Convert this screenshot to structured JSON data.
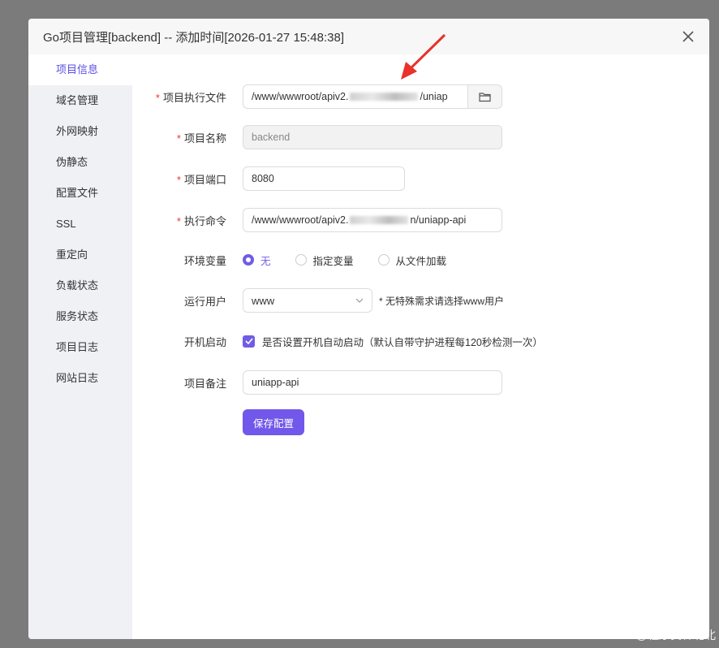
{
  "modal": {
    "title": "Go项目管理[backend] -- 添加时间[2026-01-27 15:48:38]"
  },
  "sidebar": {
    "items": [
      {
        "label": "项目信息",
        "active": true
      },
      {
        "label": "域名管理"
      },
      {
        "label": "外网映射"
      },
      {
        "label": "伪静态"
      },
      {
        "label": "配置文件"
      },
      {
        "label": "SSL"
      },
      {
        "label": "重定向"
      },
      {
        "label": "负载状态"
      },
      {
        "label": "服务状态"
      },
      {
        "label": "项目日志"
      },
      {
        "label": "网站日志"
      }
    ]
  },
  "form": {
    "exec_file": {
      "label": "项目执行文件",
      "value_prefix": "/www/wwwroot/apiv2.",
      "value_suffix": "/uniap"
    },
    "project_name": {
      "label": "项目名称",
      "value": "backend"
    },
    "project_port": {
      "label": "项目端口",
      "value": "8080"
    },
    "exec_command": {
      "label": "执行命令",
      "value_prefix": "/www/wwwroot/apiv2.",
      "value_suffix": "n/uniapp-api"
    },
    "env_vars": {
      "label": "环境变量",
      "options": [
        "无",
        "指定变量",
        "从文件加载"
      ],
      "selected": "无"
    },
    "run_user": {
      "label": "运行用户",
      "value": "www",
      "hint": "* 无特殊需求请选择www用户"
    },
    "autostart": {
      "label": "开机启动",
      "text": "是否设置开机自动启动（默认自带守护进程每120秒检测一次）",
      "checked": true
    },
    "remark": {
      "label": "项目备注",
      "value": "uniapp-api"
    },
    "save_label": "保存配置"
  },
  "watermark": "CSDN @程序员林北北",
  "colors": {
    "accent": "#7158ea",
    "required": "#e33333",
    "arrow": "#e8322a"
  }
}
